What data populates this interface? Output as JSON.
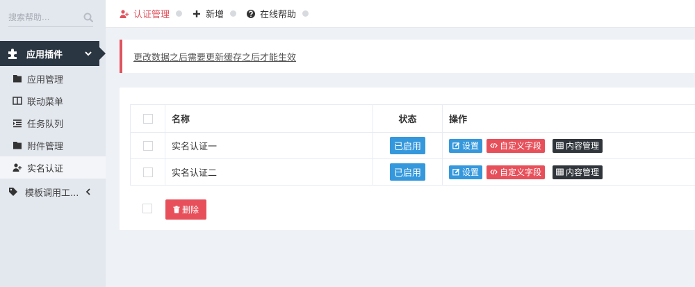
{
  "sidebar": {
    "search_placeholder": "搜索帮助...",
    "section_label": "应用插件",
    "items": [
      {
        "label": "应用管理",
        "icon": "folder-icon"
      },
      {
        "label": "联动菜单",
        "icon": "columns-icon"
      },
      {
        "label": "任务队列",
        "icon": "indent-icon"
      },
      {
        "label": "附件管理",
        "icon": "folder-icon"
      },
      {
        "label": "实名认证",
        "icon": "user-plus-icon",
        "active": true
      }
    ],
    "template_label": "模板调用工..."
  },
  "topnav": {
    "items": [
      {
        "label": "认证管理",
        "icon": "user-plus-icon",
        "active": true
      },
      {
        "label": "新增",
        "icon": "plus-icon"
      },
      {
        "label": "在线帮助",
        "icon": "question-icon"
      }
    ]
  },
  "alert": {
    "text": "更改数据之后需要更新缓存之后才能生效"
  },
  "table": {
    "headers": {
      "name": "名称",
      "status": "状态",
      "operations": "操作"
    },
    "rows": [
      {
        "name": "实名认证一",
        "status": "已启用"
      },
      {
        "name": "实名认证二",
        "status": "已启用"
      }
    ],
    "actions": {
      "settings": "设置",
      "custom_fields": "自定义字段",
      "content_manage": "内容管理"
    }
  },
  "delete_label": "删除",
  "colors": {
    "accent_red": "#e7505a",
    "primary_blue": "#3598dc",
    "dark": "#2f353b",
    "sidebar_dark": "#2b3643"
  }
}
